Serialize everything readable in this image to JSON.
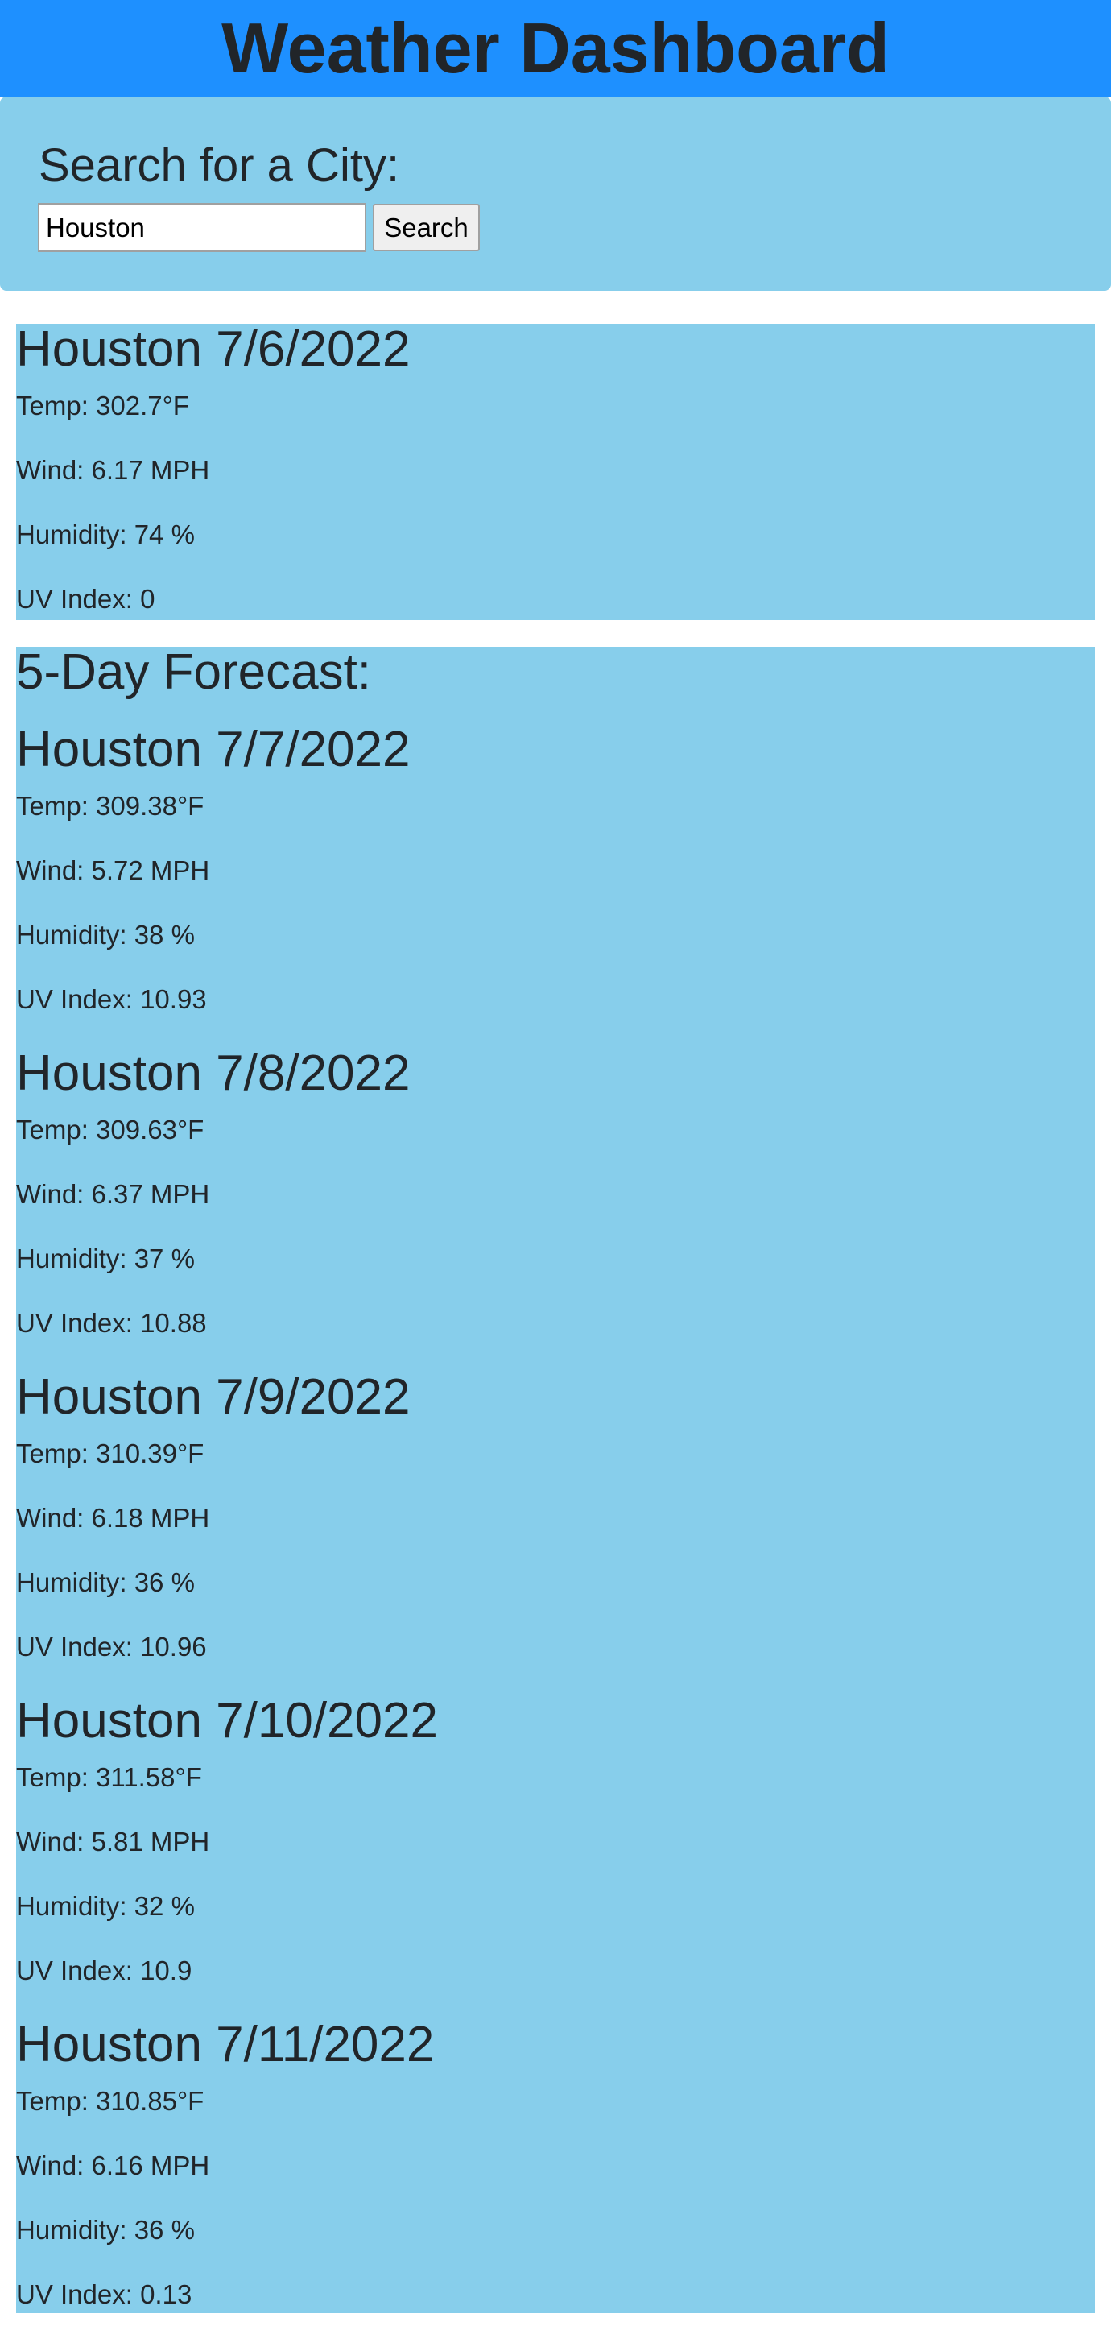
{
  "header": {
    "title": "Weather Dashboard"
  },
  "search": {
    "title": "Search for a City:",
    "input_value": "Houston",
    "button_label": "Search"
  },
  "current": {
    "heading": "Houston 7/6/2022",
    "temp": "Temp: 302.7°F",
    "wind": "Wind: 6.17 MPH",
    "humidity": "Humidity: 74 %",
    "uv": "UV Index: 0"
  },
  "forecast": {
    "title": "5-Day Forecast:",
    "days": [
      {
        "heading": "Houston 7/7/2022",
        "temp": "Temp: 309.38°F",
        "wind": "Wind: 5.72 MPH",
        "humidity": "Humidity: 38 %",
        "uv": "UV Index: 10.93"
      },
      {
        "heading": "Houston 7/8/2022",
        "temp": "Temp: 309.63°F",
        "wind": "Wind: 6.37 MPH",
        "humidity": "Humidity: 37 %",
        "uv": "UV Index: 10.88"
      },
      {
        "heading": "Houston 7/9/2022",
        "temp": "Temp: 310.39°F",
        "wind": "Wind: 6.18 MPH",
        "humidity": "Humidity: 36 %",
        "uv": "UV Index: 10.96"
      },
      {
        "heading": "Houston 7/10/2022",
        "temp": "Temp: 311.58°F",
        "wind": "Wind: 5.81 MPH",
        "humidity": "Humidity: 32 %",
        "uv": "UV Index: 10.9"
      },
      {
        "heading": "Houston 7/11/2022",
        "temp": "Temp: 310.85°F",
        "wind": "Wind: 6.16 MPH",
        "humidity": "Humidity: 36 %",
        "uv": "UV Index: 0.13"
      }
    ]
  },
  "colors": {
    "header_bg": "#1e90ff",
    "card_bg": "#87ceeb",
    "text": "#212529"
  }
}
